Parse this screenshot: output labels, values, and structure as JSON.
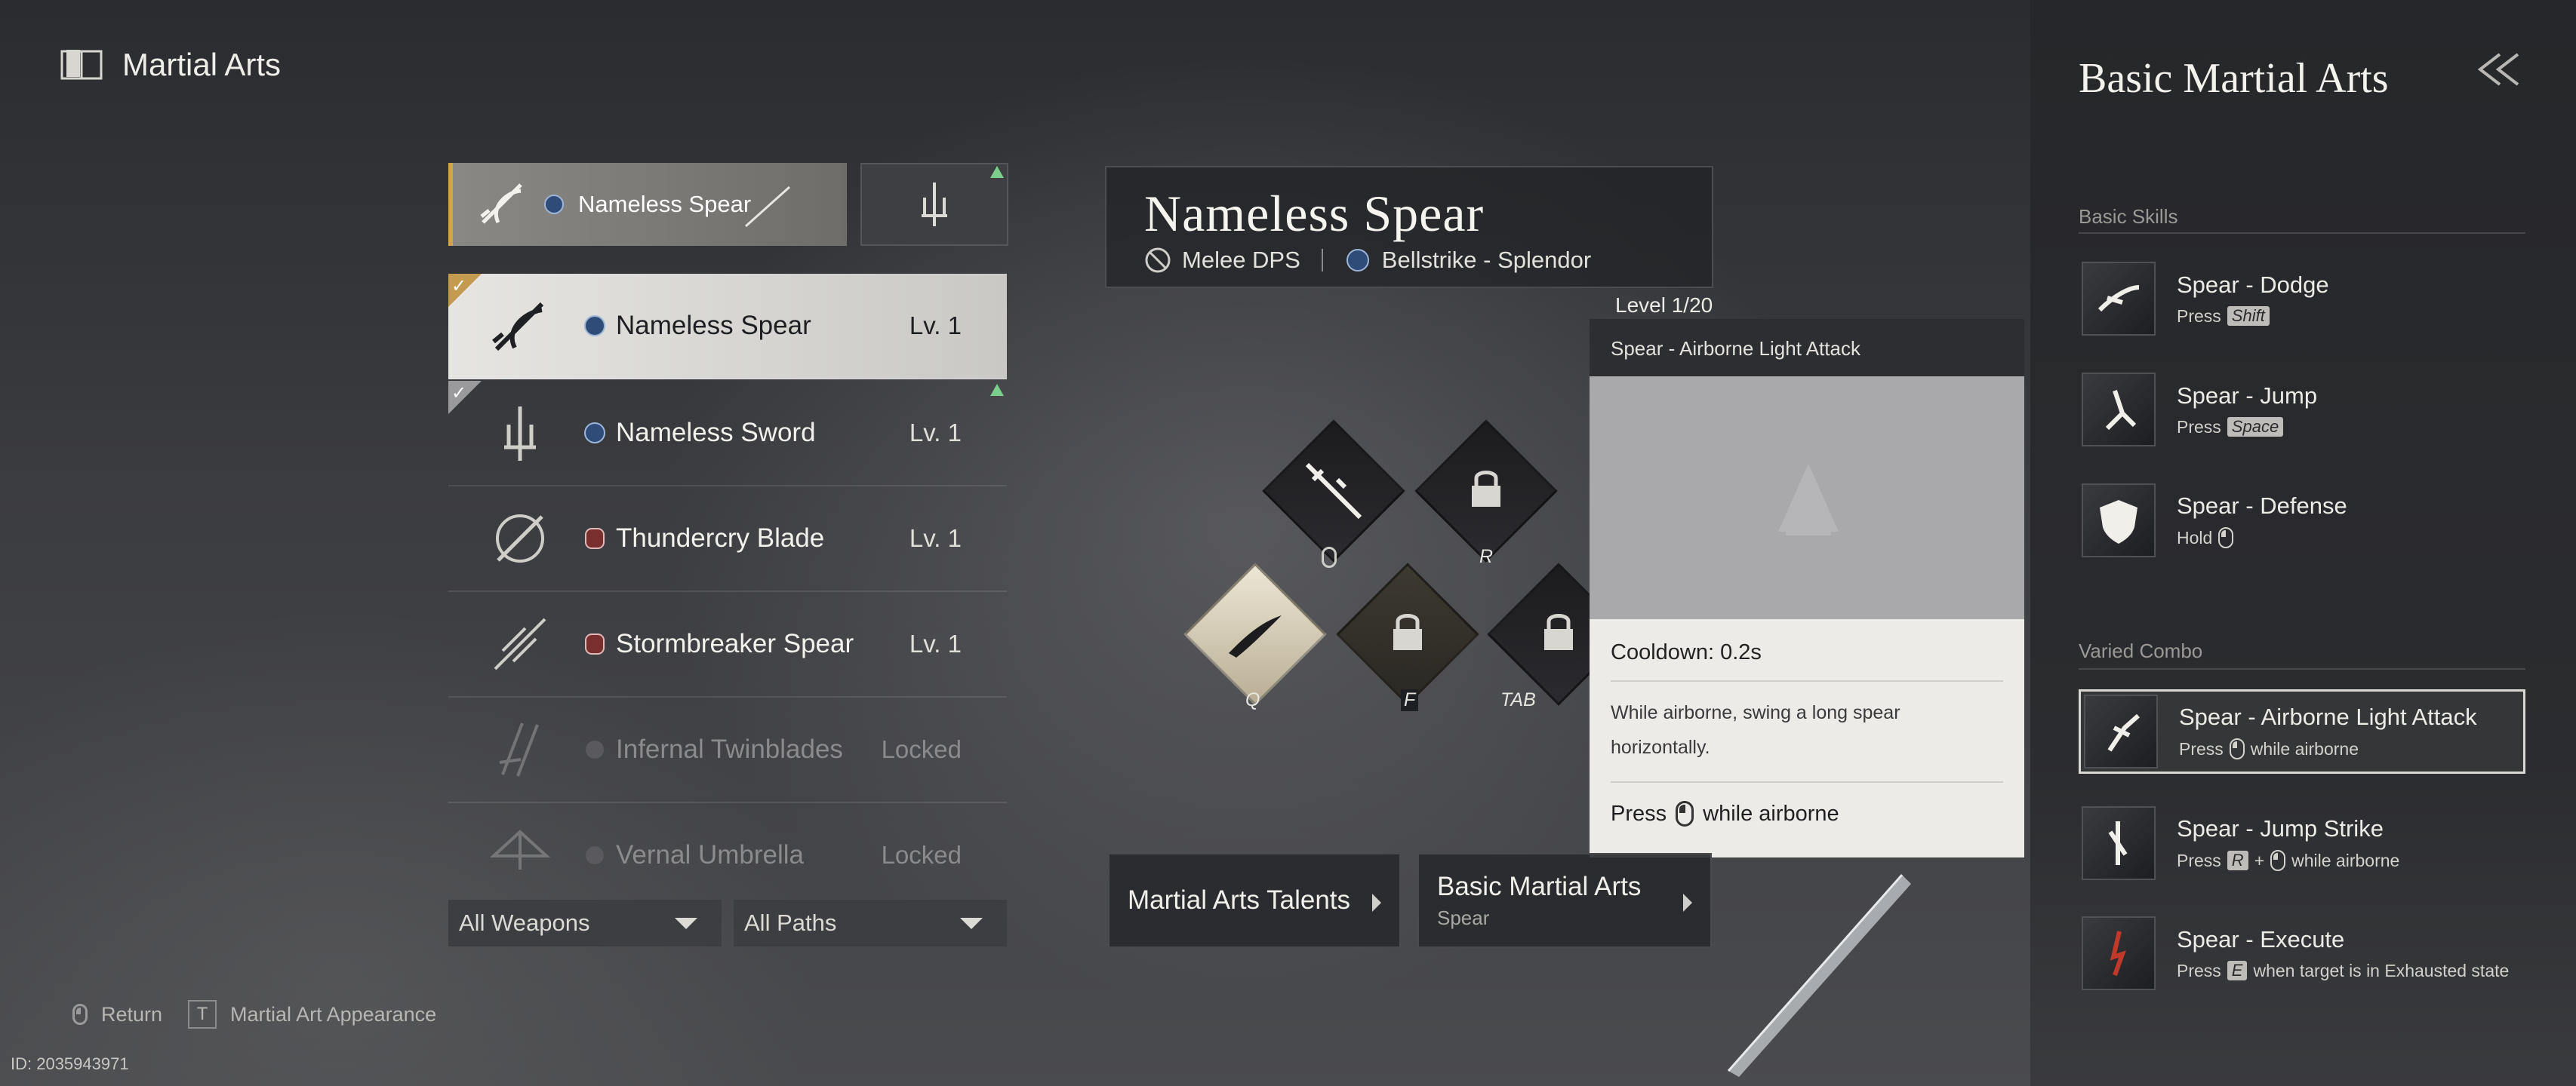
{
  "header": {
    "title": "Martial Arts"
  },
  "current_weapon": {
    "name": "Nameless Spear"
  },
  "weapons": [
    {
      "name": "Nameless Spear",
      "level": "Lv. 1"
    },
    {
      "name": "Nameless Sword",
      "level": "Lv. 1"
    },
    {
      "name": "Thundercry Blade",
      "level": "Lv. 1"
    },
    {
      "name": "Stormbreaker Spear",
      "level": "Lv. 1"
    },
    {
      "name": "Infernal Twinblades",
      "level": "Locked"
    },
    {
      "name": "Vernal Umbrella",
      "level": "Locked"
    }
  ],
  "filters": {
    "weapons": "All Weapons",
    "paths": "All Paths"
  },
  "hints": {
    "return": "Return",
    "appearance_key": "T",
    "appearance": "Martial Art Appearance"
  },
  "player_id": "ID: 2035943971",
  "weapon_detail": {
    "title": "Nameless Spear",
    "role": "Melee DPS",
    "path": "Bellstrike - Splendor"
  },
  "skill_keys": {
    "lmb": "",
    "r": "R",
    "q": "Q",
    "f": "F",
    "tab": "TAB"
  },
  "level_label": "Level 1/20",
  "tooltip": {
    "title": "Spear - Airborne Light Attack",
    "cooldown": "Cooldown: 0.2s",
    "description": "While airborne, swing a long spear horizontally.",
    "press": "Press",
    "press_suffix": "while airborne"
  },
  "buttons": {
    "talents": "Martial Arts Talents",
    "basic": "Basic Martial Arts",
    "basic_sub": "Spear"
  },
  "right_panel": {
    "title": "Basic Martial Arts",
    "basic_skills_header": "Basic Skills",
    "varied_combo_header": "Varied Combo",
    "basic_skills": [
      {
        "name": "Spear - Dodge",
        "hint": "Press",
        "key": "Shift"
      },
      {
        "name": "Spear - Jump",
        "hint": "Press",
        "key": "Space"
      },
      {
        "name": "Spear - Defense",
        "hint": "Hold"
      }
    ],
    "combo_skills": [
      {
        "name": "Spear - Airborne Light Attack",
        "hint": "Press",
        "suffix": "while airborne"
      },
      {
        "name": "Spear - Jump Strike",
        "hint": "Press",
        "key": "R",
        "plus": "+",
        "suffix": "while airborne"
      },
      {
        "name": "Spear - Execute",
        "hint": "Press",
        "key": "E",
        "suffix": "when target is in Exhausted state"
      }
    ]
  },
  "colors": {
    "accent_gold": "#d4a24a",
    "upgrade_green": "#7ccf8a",
    "panel_dark": "#26272a"
  },
  "icons": [
    "book-icon",
    "spear-icon",
    "sword-icon",
    "blade-icon",
    "twinblades-icon",
    "umbrella-icon",
    "back-arrows-icon",
    "mouse-icon",
    "shield-icon"
  ]
}
